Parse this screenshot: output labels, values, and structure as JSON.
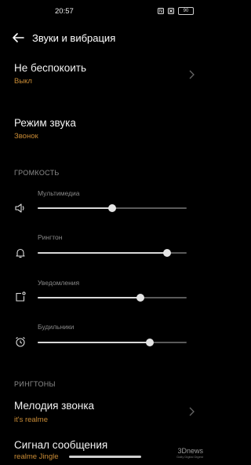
{
  "status_bar": {
    "time": "20:57",
    "icons": [
      "nfc-icon",
      "mute-icon"
    ],
    "battery": "90"
  },
  "header": {
    "title": "Звуки и вибрация",
    "back_icon": "arrow-left-icon"
  },
  "items": [
    {
      "title": "Не беспокоить",
      "subtitle": "Выкл"
    },
    {
      "title": "Режим звука",
      "subtitle": "Звонок"
    }
  ],
  "volume": {
    "section_label": "ГРОМКОСТЬ",
    "sliders": [
      {
        "label": "Мультимедиа",
        "icon": "speaker-icon",
        "value": 0.5
      },
      {
        "label": "Рингтон",
        "icon": "bell-icon",
        "value": 0.87
      },
      {
        "label": "Уведомления",
        "icon": "notification-icon",
        "value": 0.69
      },
      {
        "label": "Будильники",
        "icon": "alarm-icon",
        "value": 0.75
      }
    ]
  },
  "ringtones": {
    "section_label": "РИНГТОНЫ",
    "items": [
      {
        "title": "Мелодия звонка",
        "subtitle": "it's realme"
      },
      {
        "title": "Сигнал сообщения",
        "subtitle": "realme Jingle"
      }
    ]
  },
  "watermark": {
    "text": "3Dnews",
    "subtext": "Daily Digital Digest"
  },
  "colors": {
    "accent": "#c98b35",
    "background": "#000000",
    "thumb": "#e5e5e5"
  }
}
